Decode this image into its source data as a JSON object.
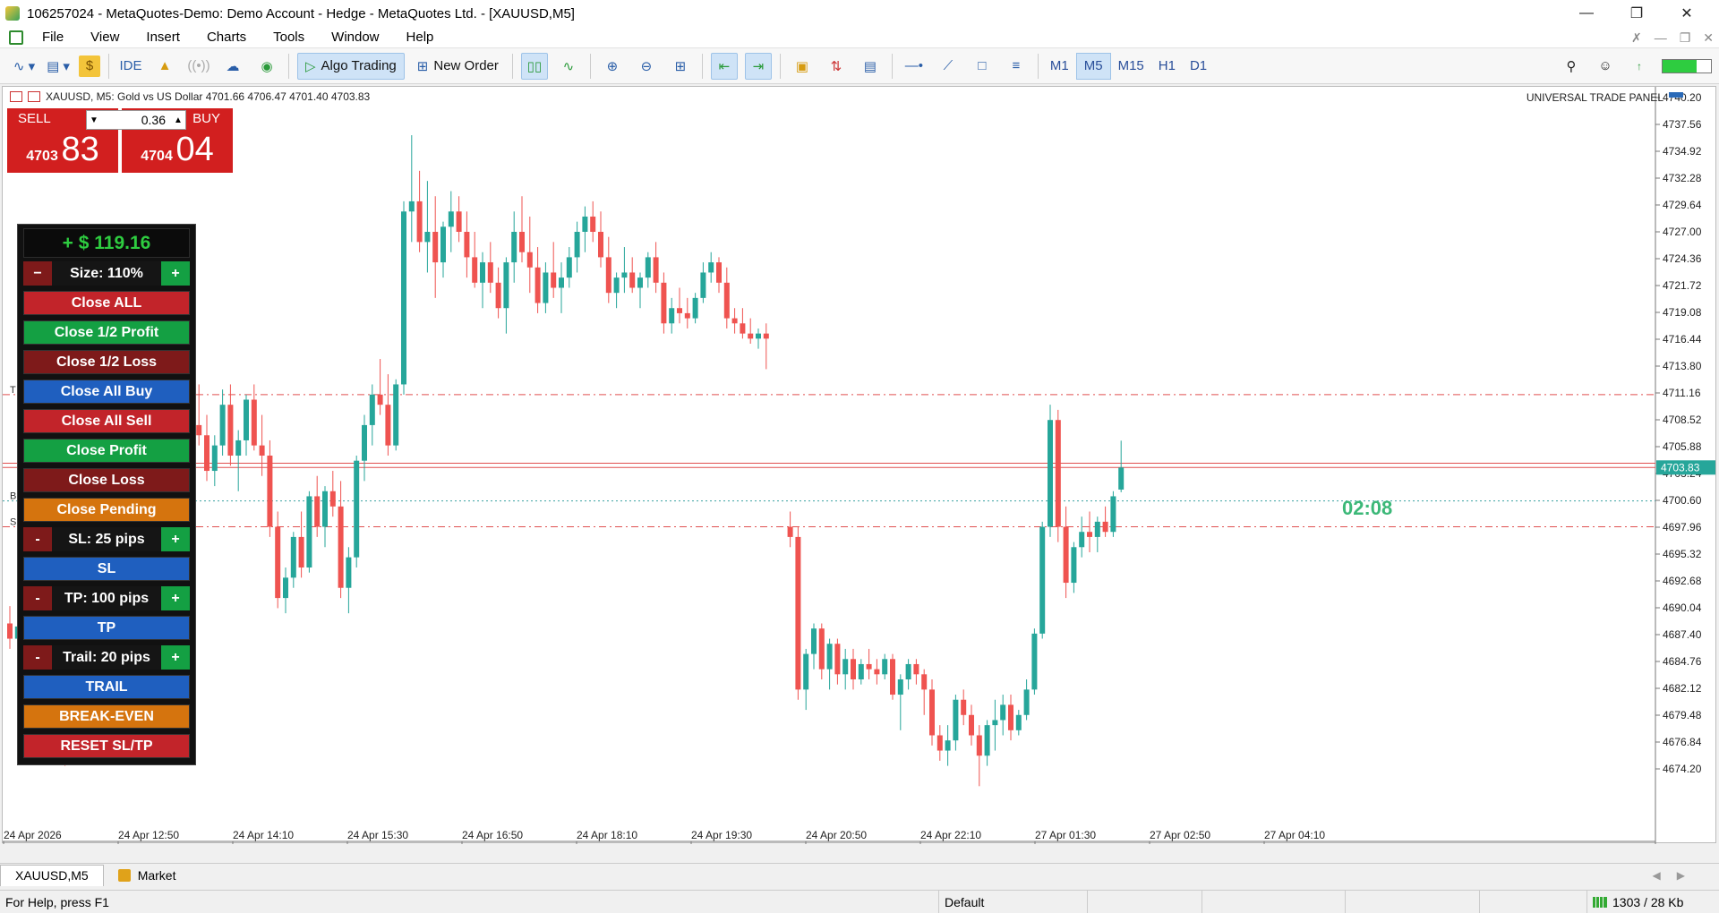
{
  "window": {
    "title": "106257024 - MetaQuotes-Demo: Demo Account - Hedge - MetaQuotes Ltd. - [XAUUSD,M5]"
  },
  "menu": [
    "File",
    "View",
    "Insert",
    "Charts",
    "Tools",
    "Window",
    "Help"
  ],
  "toolbar": {
    "ide_label": "IDE",
    "algo_trading_label": "Algo Trading",
    "new_order_label": "New Order",
    "timeframes": [
      "M1",
      "M5",
      "M15",
      "H1",
      "D1"
    ],
    "active_timeframe": "M5",
    "level_indicator": 0.7
  },
  "chart_header": {
    "info": "XAUUSD, M5:  Gold vs US Dollar  4701.66 4706.47 4701.40 4703.83",
    "panel_title": "UNIVERSAL TRADE PANEL"
  },
  "one_click": {
    "sell_label": "SELL",
    "buy_label": "BUY",
    "lot": "0.36",
    "sell_small": "4703",
    "sell_big": "83",
    "buy_small": "4704",
    "buy_big": "04"
  },
  "trade_panel": {
    "profit": "+ $ 119.16",
    "size_minus": "−",
    "size_label": "Size: 110%",
    "size_plus": "+",
    "close_all": "Close ALL",
    "close_half_profit": "Close 1/2 Profit",
    "close_half_loss": "Close 1/2 Loss",
    "close_all_buy": "Close All Buy",
    "close_all_sell": "Close All Sell",
    "close_profit": "Close Profit",
    "close_loss": "Close Loss",
    "close_pending": "Close Pending",
    "sl_minus": "-",
    "sl_label": "SL: 25 pips",
    "sl_plus": "+",
    "sl_button": "SL",
    "tp_minus": "-",
    "tp_label": "TP: 100 pips",
    "tp_plus": "+",
    "tp_button": "TP",
    "trail_minus": "-",
    "trail_label": "Trail: 20 pips",
    "trail_plus": "+",
    "trail_button": "TRAIL",
    "break_even": "BREAK-EVEN",
    "reset": "RESET SL/TP"
  },
  "bar_timer": "02:08",
  "line_markers": {
    "t": "T",
    "b": "B",
    "s": "S"
  },
  "chart_data": {
    "type": "candlestick",
    "symbol": "XAUUSD",
    "timeframe": "M5",
    "ylim": [
      4672.0,
      4740.2
    ],
    "y_ticks": [
      "4740.20",
      "4737.56",
      "4734.92",
      "4732.28",
      "4729.64",
      "4727.00",
      "4724.36",
      "4721.72",
      "4719.08",
      "4716.44",
      "4713.80",
      "4711.16",
      "4708.52",
      "4705.88",
      "4703.24",
      "4700.60",
      "4697.96",
      "4695.32",
      "4692.68",
      "4690.04",
      "4687.40",
      "4684.76",
      "4682.12",
      "4679.48",
      "4676.84",
      "4674.20"
    ],
    "x_ticks": [
      "24 Apr 2026",
      "24 Apr 12:50",
      "24 Apr 14:10",
      "24 Apr 15:30",
      "24 Apr 16:50",
      "24 Apr 18:10",
      "24 Apr 19:30",
      "24 Apr 20:50",
      "24 Apr 22:10",
      "27 Apr 01:30",
      "27 Apr 02:50",
      "27 Apr 04:10"
    ],
    "current_price": 4703.83,
    "current_price_label": "4703.83",
    "levels": [
      {
        "name": "take-profit-line",
        "price": 4711.0,
        "style": "dashdot",
        "color": "#e05050"
      },
      {
        "name": "ask-line",
        "price": 4704.25,
        "style": "solid",
        "color": "#e05050"
      },
      {
        "name": "bid-line",
        "price": 4703.83,
        "style": "solid",
        "color": "#e05050"
      },
      {
        "name": "breakeven-line",
        "price": 4700.55,
        "style": "dotted",
        "color": "#3aa0a0"
      },
      {
        "name": "stop-loss-line",
        "price": 4698.0,
        "style": "dashdot",
        "color": "#e05050"
      }
    ],
    "colors": {
      "up": "#26a69a",
      "down": "#ef5350",
      "price_tag": "#26a69a"
    },
    "candles": [
      [
        4688.5,
        4690.2,
        4686.0,
        4687.0
      ],
      [
        4687.0,
        4689.0,
        4685.5,
        4688.2
      ],
      [
        4688.2,
        4690.5,
        4687.0,
        4689.5
      ],
      [
        4689.5,
        4691.0,
        4686.0,
        4687.0
      ],
      [
        4687.0,
        4688.0,
        4682.0,
        4683.0
      ],
      [
        4683.0,
        4684.5,
        4680.0,
        4681.0
      ],
      [
        4681.0,
        4682.0,
        4677.5,
        4678.5
      ],
      [
        4678.5,
        4679.5,
        4674.5,
        4675.5
      ],
      [
        4675.5,
        4678.0,
        4674.8,
        4677.5
      ],
      [
        4677.5,
        4680.0,
        4676.0,
        4679.0
      ],
      [
        4679.0,
        4680.5,
        4676.5,
        4678.0
      ],
      [
        4678.0,
        4679.0,
        4676.0,
        4677.0
      ],
      [
        4677.0,
        4679.5,
        4676.5,
        4679.0
      ],
      [
        4679.0,
        4690.5,
        4678.5,
        4690.0
      ],
      [
        4690.0,
        4697.5,
        4689.0,
        4697.0
      ],
      [
        4697.0,
        4700.0,
        4695.0,
        4696.0
      ],
      [
        4696.0,
        4701.0,
        4694.5,
        4700.0
      ],
      [
        4700.0,
        4711.0,
        4699.0,
        4710.0
      ],
      [
        4710.0,
        4716.5,
        4709.0,
        4716.0
      ],
      [
        4716.0,
        4718.5,
        4710.0,
        4711.0
      ],
      [
        4711.0,
        4713.5,
        4707.0,
        4708.0
      ],
      [
        4708.0,
        4709.5,
        4705.5,
        4706.5
      ],
      [
        4706.5,
        4709.0,
        4704.0,
        4705.0
      ],
      [
        4705.0,
        4708.5,
        4703.0,
        4708.0
      ],
      [
        4708.0,
        4712.0,
        4706.0,
        4707.0
      ],
      [
        4707.0,
        4709.0,
        4702.5,
        4703.5
      ],
      [
        4703.5,
        4707.0,
        4702.0,
        4706.0
      ],
      [
        4706.0,
        4711.5,
        4705.0,
        4710.0
      ],
      [
        4710.0,
        4712.0,
        4704.0,
        4705.0
      ],
      [
        4705.0,
        4707.5,
        4701.5,
        4706.5
      ],
      [
        4706.5,
        4711.0,
        4705.0,
        4710.5
      ],
      [
        4710.5,
        4712.0,
        4705.5,
        4706.0
      ],
      [
        4706.0,
        4709.0,
        4703.0,
        4705.0
      ],
      [
        4705.0,
        4706.5,
        4697.0,
        4698.0
      ],
      [
        4698.0,
        4699.5,
        4690.0,
        4691.0
      ],
      [
        4691.0,
        4694.0,
        4689.5,
        4693.0
      ],
      [
        4693.0,
        4697.5,
        4692.0,
        4697.0
      ],
      [
        4697.0,
        4699.5,
        4693.0,
        4694.0
      ],
      [
        4694.0,
        4701.5,
        4693.5,
        4701.0
      ],
      [
        4701.0,
        4703.0,
        4697.0,
        4698.0
      ],
      [
        4698.0,
        4702.0,
        4696.0,
        4701.5
      ],
      [
        4701.5,
        4703.5,
        4699.0,
        4700.0
      ],
      [
        4700.0,
        4702.5,
        4691.0,
        4692.0
      ],
      [
        4692.0,
        4696.0,
        4689.5,
        4695.0
      ],
      [
        4695.0,
        4705.0,
        4694.0,
        4704.5
      ],
      [
        4704.5,
        4709.0,
        4702.5,
        4708.0
      ],
      [
        4708.0,
        4712.0,
        4706.0,
        4711.0
      ],
      [
        4711.0,
        4714.5,
        4709.0,
        4710.0
      ],
      [
        4710.0,
        4713.0,
        4705.0,
        4706.0
      ],
      [
        4706.0,
        4712.5,
        4705.5,
        4712.0
      ],
      [
        4712.0,
        4730.0,
        4711.0,
        4729.0
      ],
      [
        4729.0,
        4736.5,
        4726.0,
        4730.0
      ],
      [
        4730.0,
        4733.0,
        4725.0,
        4726.0
      ],
      [
        4726.0,
        4732.0,
        4723.0,
        4727.0
      ],
      [
        4727.0,
        4730.5,
        4720.5,
        4724.0
      ],
      [
        4724.0,
        4728.0,
        4722.5,
        4727.5
      ],
      [
        4727.5,
        4731.0,
        4725.0,
        4729.0
      ],
      [
        4729.0,
        4730.5,
        4726.0,
        4727.0
      ],
      [
        4727.0,
        4729.0,
        4722.5,
        4724.5
      ],
      [
        4724.5,
        4727.0,
        4721.5,
        4722.0
      ],
      [
        4722.0,
        4725.0,
        4719.5,
        4724.0
      ],
      [
        4724.0,
        4726.0,
        4721.0,
        4722.0
      ],
      [
        4722.0,
        4723.5,
        4718.5,
        4719.5
      ],
      [
        4719.5,
        4724.5,
        4717.0,
        4724.0
      ],
      [
        4724.0,
        4729.0,
        4722.0,
        4727.0
      ],
      [
        4727.0,
        4730.5,
        4724.0,
        4725.0
      ],
      [
        4725.0,
        4728.5,
        4721.0,
        4723.5
      ],
      [
        4723.5,
        4725.5,
        4719.0,
        4720.0
      ],
      [
        4720.0,
        4724.0,
        4719.0,
        4723.0
      ],
      [
        4723.0,
        4726.0,
        4720.5,
        4721.5
      ],
      [
        4721.5,
        4724.0,
        4719.0,
        4722.5
      ],
      [
        4722.5,
        4725.5,
        4721.5,
        4724.5
      ],
      [
        4724.5,
        4728.0,
        4723.0,
        4727.0
      ],
      [
        4727.0,
        4729.5,
        4725.0,
        4728.5
      ],
      [
        4728.5,
        4730.0,
        4726.0,
        4727.0
      ],
      [
        4727.0,
        4729.0,
        4723.5,
        4724.5
      ],
      [
        4724.5,
        4726.5,
        4720.0,
        4721.0
      ],
      [
        4721.0,
        4723.0,
        4719.5,
        4722.5
      ],
      [
        4722.5,
        4725.5,
        4721.0,
        4723.0
      ],
      [
        4723.0,
        4724.5,
        4721.0,
        4721.5
      ],
      [
        4721.5,
        4723.0,
        4719.5,
        4722.5
      ],
      [
        4722.5,
        4725.0,
        4721.5,
        4724.5
      ],
      [
        4724.5,
        4726.0,
        4721.0,
        4722.0
      ],
      [
        4722.0,
        4723.0,
        4717.0,
        4718.0
      ],
      [
        4718.0,
        4720.5,
        4717.0,
        4719.5
      ],
      [
        4719.5,
        4721.5,
        4718.0,
        4719.0
      ],
      [
        4719.0,
        4720.5,
        4717.5,
        4718.5
      ],
      [
        4718.5,
        4721.0,
        4718.0,
        4720.5
      ],
      [
        4720.5,
        4724.0,
        4720.0,
        4723.0
      ],
      [
        4723.0,
        4725.0,
        4722.0,
        4724.0
      ],
      [
        4724.0,
        4724.5,
        4721.0,
        4722.0
      ],
      [
        4722.0,
        4723.5,
        4717.5,
        4718.5
      ],
      [
        4718.5,
        4719.5,
        4717.0,
        4718.0
      ],
      [
        4718.0,
        4719.5,
        4716.5,
        4717.0
      ],
      [
        4717.0,
        4718.5,
        4716.0,
        4716.5
      ],
      [
        4716.5,
        4717.5,
        4715.5,
        4717.0
      ],
      [
        4717.0,
        4718.0,
        4713.5,
        4716.5
      ],
      [
        4698.0,
        4699.5,
        4696.0,
        4697.0
      ],
      [
        4697.0,
        4698.0,
        4681.0,
        4682.0
      ],
      [
        4682.0,
        4686.0,
        4680.0,
        4685.5
      ],
      [
        4685.5,
        4688.5,
        4684.0,
        4688.0
      ],
      [
        4688.0,
        4688.5,
        4683.0,
        4684.0
      ],
      [
        4684.0,
        4687.0,
        4682.0,
        4686.5
      ],
      [
        4686.5,
        4687.0,
        4682.5,
        4683.5
      ],
      [
        4683.5,
        4686.0,
        4682.0,
        4685.0
      ],
      [
        4685.0,
        4686.0,
        4682.0,
        4683.0
      ],
      [
        4683.0,
        4685.0,
        4682.5,
        4684.5
      ],
      [
        4684.5,
        4686.0,
        4683.0,
        4684.0
      ],
      [
        4684.0,
        4685.0,
        4682.5,
        4683.5
      ],
      [
        4683.5,
        4685.5,
        4683.0,
        4685.0
      ],
      [
        4685.0,
        4685.5,
        4681.0,
        4681.5
      ],
      [
        4681.5,
        4683.5,
        4678.0,
        4683.0
      ],
      [
        4683.0,
        4685.0,
        4682.0,
        4684.5
      ],
      [
        4684.5,
        4685.0,
        4682.5,
        4683.5
      ],
      [
        4683.5,
        4684.0,
        4679.5,
        4682.0
      ],
      [
        4682.0,
        4683.0,
        4676.5,
        4677.5
      ],
      [
        4677.5,
        4678.5,
        4675.0,
        4676.0
      ],
      [
        4676.0,
        4678.5,
        4674.5,
        4677.0
      ],
      [
        4677.0,
        4681.5,
        4676.0,
        4681.0
      ],
      [
        4681.0,
        4682.0,
        4678.5,
        4679.5
      ],
      [
        4679.5,
        4680.5,
        4676.5,
        4677.5
      ],
      [
        4677.5,
        4678.5,
        4672.5,
        4675.5
      ],
      [
        4675.5,
        4679.0,
        4674.5,
        4678.5
      ],
      [
        4678.5,
        4681.0,
        4676.0,
        4679.0
      ],
      [
        4679.0,
        4681.5,
        4677.5,
        4680.5
      ],
      [
        4680.5,
        4681.5,
        4677.0,
        4678.0
      ],
      [
        4678.0,
        4680.0,
        4677.5,
        4679.5
      ],
      [
        4679.5,
        4683.0,
        4679.0,
        4682.0
      ],
      [
        4682.0,
        4688.0,
        4681.5,
        4687.5
      ],
      [
        4687.5,
        4698.5,
        4687.0,
        4698.0
      ],
      [
        4698.0,
        4710.0,
        4697.0,
        4708.5
      ],
      [
        4708.5,
        4709.5,
        4696.5,
        4698.0
      ],
      [
        4698.0,
        4700.0,
        4691.0,
        4692.5
      ],
      [
        4692.5,
        4696.5,
        4691.5,
        4696.0
      ],
      [
        4696.0,
        4699.0,
        4695.0,
        4697.5
      ],
      [
        4697.5,
        4699.5,
        4695.5,
        4697.0
      ],
      [
        4697.0,
        4699.0,
        4695.5,
        4698.5
      ],
      [
        4698.5,
        4700.0,
        4697.0,
        4697.5
      ],
      [
        4697.5,
        4701.5,
        4697.0,
        4701.0
      ],
      [
        4701.66,
        4706.47,
        4701.4,
        4703.83
      ]
    ]
  },
  "bottom_tabs": {
    "chart_tab": "XAUUSD,M5",
    "market_tab": "Market"
  },
  "status": {
    "help": "For Help, press F1",
    "profile": "Default",
    "traffic": "1303 / 28 Kb"
  }
}
